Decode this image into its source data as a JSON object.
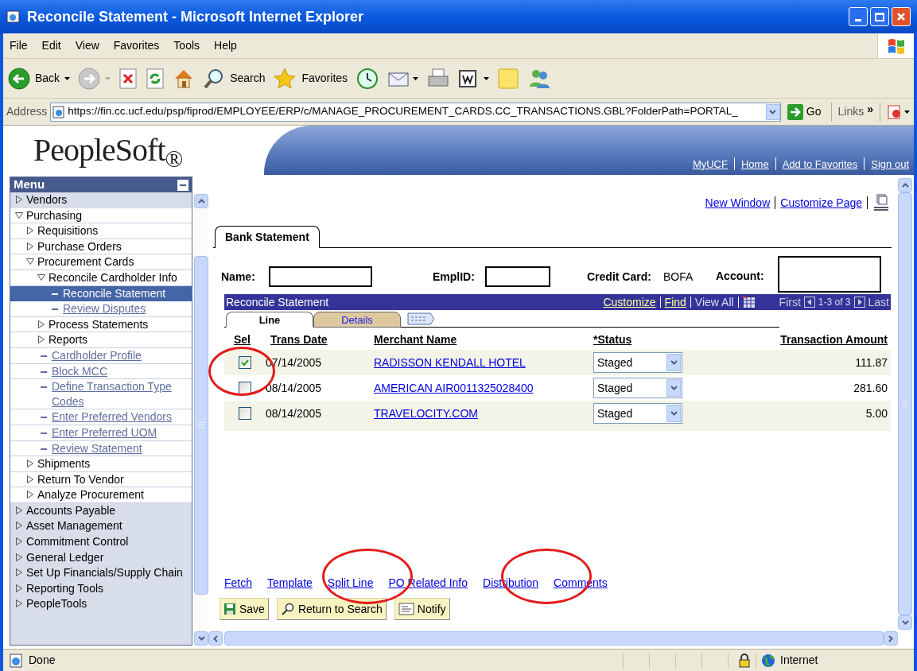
{
  "window": {
    "title": "Reconcile Statement - Microsoft Internet Explorer"
  },
  "menu_bar": [
    "File",
    "Edit",
    "View",
    "Favorites",
    "Tools",
    "Help"
  ],
  "toolbar": [
    {
      "kind": "back",
      "label": "Back"
    },
    {
      "kind": "forward"
    },
    {
      "kind": "stop"
    },
    {
      "kind": "refresh"
    },
    {
      "kind": "home"
    },
    {
      "kind": "search",
      "label": "Search"
    },
    {
      "kind": "favorites",
      "label": "Favorites"
    },
    {
      "kind": "history"
    },
    {
      "kind": "mail"
    },
    {
      "kind": "print"
    },
    {
      "kind": "word"
    },
    {
      "kind": "note"
    },
    {
      "kind": "messenger"
    }
  ],
  "address_bar": {
    "label": "Address",
    "url": "https://fin.cc.ucf.edu/psp/fiprod/EMPLOYEE/ERP/c/MANAGE_PROCUREMENT_CARDS.CC_TRANSACTIONS.GBL?FolderPath=PORTAL_",
    "go": "Go",
    "links": "Links",
    "chevron": "»"
  },
  "header": {
    "logo": "PeopleSoft$_{®}$",
    "links": [
      "MyUCF",
      "Home",
      "Add to Favorites",
      "Sign out"
    ]
  },
  "menu": {
    "title": "Menu",
    "items": [
      {
        "kind": "folder",
        "label": "Vendors",
        "expanded": false
      },
      {
        "kind": "folder",
        "label": "Purchasing",
        "expanded": true,
        "children": [
          {
            "kind": "folder",
            "label": "Requisitions",
            "expanded": false
          },
          {
            "kind": "folder",
            "label": "Purchase Orders",
            "expanded": false
          },
          {
            "kind": "folder",
            "label": "Procurement Cards",
            "expanded": true,
            "children": [
              {
                "kind": "folder",
                "label": "Reconcile Cardholder Info",
                "expanded": true,
                "children": [
                  {
                    "kind": "link",
                    "label": "Reconcile Statement",
                    "selected": true
                  },
                  {
                    "kind": "link",
                    "label": "Review Disputes",
                    "selected": false
                  }
                ]
              },
              {
                "kind": "folder",
                "label": "Process Statements",
                "expanded": false
              },
              {
                "kind": "folder",
                "label": "Reports",
                "expanded": false
              },
              {
                "kind": "link",
                "label": "Cardholder Profile",
                "selected": false
              },
              {
                "kind": "link",
                "label": "Block MCC",
                "selected": false
              },
              {
                "kind": "link",
                "label": "Define Transaction Type Codes",
                "selected": false
              },
              {
                "kind": "link",
                "label": "Enter Preferred Vendors",
                "selected": false
              },
              {
                "kind": "link",
                "label": "Enter Preferred UOM",
                "selected": false
              },
              {
                "kind": "link",
                "label": "Review Statement",
                "selected": false
              }
            ]
          },
          {
            "kind": "folder",
            "label": "Shipments",
            "expanded": false
          },
          {
            "kind": "folder",
            "label": "Return To Vendor",
            "expanded": false
          },
          {
            "kind": "folder",
            "label": "Analyze Procurement",
            "expanded": false
          }
        ]
      },
      {
        "kind": "folder",
        "label": "Accounts Payable",
        "expanded": false
      },
      {
        "kind": "folder",
        "label": "Asset Management",
        "expanded": false
      },
      {
        "kind": "folder",
        "label": "Commitment Control",
        "expanded": false
      },
      {
        "kind": "folder",
        "label": "General Ledger",
        "expanded": false
      },
      {
        "kind": "folder",
        "label": "Set Up Financials/Supply Chain",
        "expanded": false
      },
      {
        "kind": "folder",
        "label": "Reporting Tools",
        "expanded": false
      },
      {
        "kind": "folder",
        "label": "PeopleTools",
        "expanded": false
      }
    ]
  },
  "page": {
    "top_links": [
      "New Window",
      "Customize Page"
    ],
    "page_tab": "Bank Statement",
    "fields": [
      {
        "kind": "redacted",
        "label": "Name:"
      },
      {
        "kind": "redacted",
        "label": "EmplID:"
      },
      {
        "kind": "value",
        "label": "Credit Card:",
        "value": "BOFA"
      },
      {
        "kind": "redacted",
        "label": "Account:"
      }
    ],
    "grid": {
      "title": "Reconcile Statement",
      "links": [
        "Customize",
        "Find"
      ],
      "view_all": "View All",
      "first": "First",
      "range": "1-3 of 3",
      "last": "Last",
      "tabs": [
        {
          "label": "Line",
          "selected": true
        },
        {
          "label": "Details",
          "selected": false
        }
      ],
      "columns": [
        "Sel",
        "Trans Date",
        "Merchant Name",
        "*Status",
        "Transaction Amount"
      ],
      "rows": [
        {
          "checked": true,
          "date": "07/14/2005",
          "merchant": "RADISSON KENDALL HOTEL",
          "status": "Staged",
          "amount": "111.87"
        },
        {
          "checked": false,
          "date": "08/14/2005",
          "merchant": "AMERICAN AIR0011325028400",
          "status": "Staged",
          "amount": "281.60"
        },
        {
          "checked": false,
          "date": "08/14/2005",
          "merchant": "TRAVELOCITY.COM",
          "status": "Staged",
          "amount": "5.00"
        }
      ]
    },
    "action_links": [
      "Fetch",
      "Template",
      "Split Line",
      "PO Related Info",
      "Distribution",
      "Comments"
    ],
    "buttons": [
      {
        "kind": "save",
        "label": "Save"
      },
      {
        "kind": "search",
        "label": "Return to Search"
      },
      {
        "kind": "notify",
        "label": "Notify"
      }
    ]
  },
  "status_bar": {
    "text": "Done",
    "zone": "Internet"
  }
}
